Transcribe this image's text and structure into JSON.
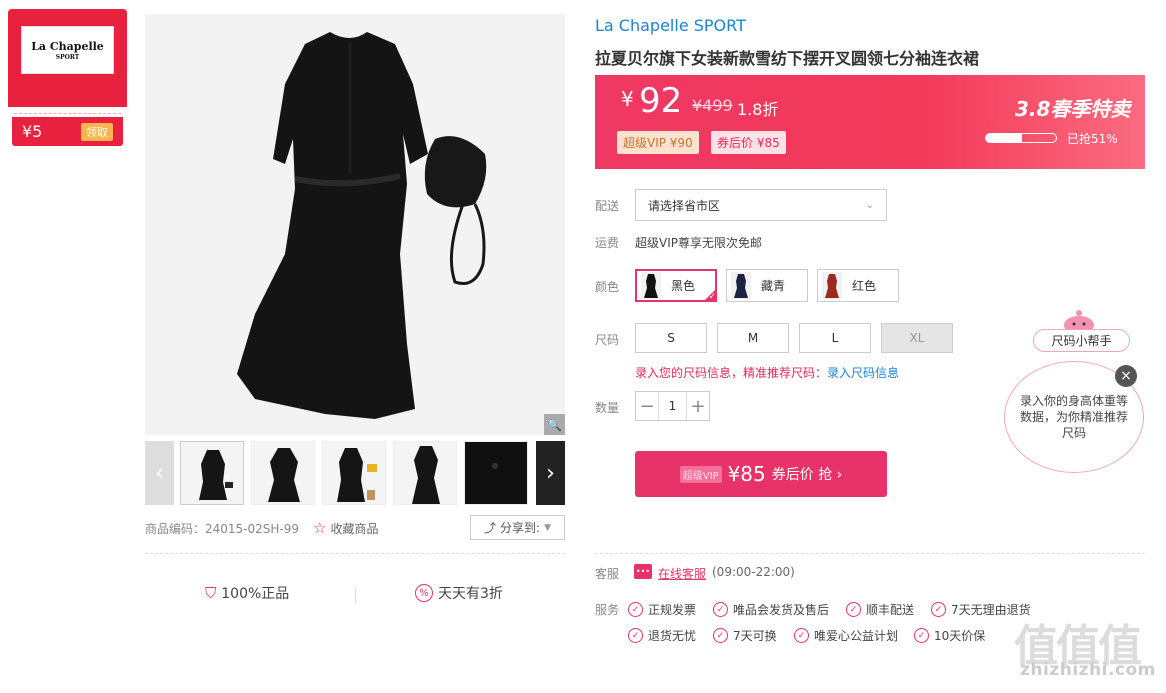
{
  "coupon": {
    "brand_line1": "La Chapelle",
    "brand_line2": "SPORT",
    "amount": "¥5",
    "claim_label": "领取"
  },
  "gallery": {
    "product_code_label": "商品编码：24015-02SH-99",
    "favorite_label": "收藏商品",
    "share_label": "分享到: ",
    "prev_arrow": "‹",
    "next_arrow": "›",
    "zoom_icon": "🔍"
  },
  "guarantees": [
    {
      "label": "100%正品"
    },
    {
      "label": "天天有3折"
    }
  ],
  "product": {
    "brand": "La Chapelle SPORT",
    "title": "拉夏贝尔旗下女装新款雪纺下摆开叉圆领七分袖连衣裙"
  },
  "price": {
    "yen": "¥",
    "current": "92",
    "original": "¥499",
    "discount": "1.8折",
    "vip_tag": "超级VIP ¥90",
    "coupon_tag": "券后价 ¥85",
    "promo_title": "3.8春季特卖",
    "sold_label": "已抢51%",
    "sold_fraction": 0.51
  },
  "delivery": {
    "label": "配送",
    "select_value": "请选择省市区",
    "freight_label": "运费",
    "freight_value": "超级VIP尊享无限次免邮"
  },
  "colors": {
    "label": "颜色",
    "options": [
      {
        "name": "黑色",
        "swatch": "#111111"
      },
      {
        "name": "藏青",
        "swatch": "#1b2340"
      },
      {
        "name": "红色",
        "swatch": "#9c2a1e"
      }
    ]
  },
  "sizes": {
    "label": "尺码",
    "options": [
      "S",
      "M",
      "L",
      "XL"
    ],
    "info_text": "录入您的尺码信息，精准推荐尺码：",
    "info_link": "录入尺码信息"
  },
  "quantity": {
    "label": "数量",
    "value": "1",
    "minus": "−",
    "plus": "+"
  },
  "buy_button": {
    "vip": "超级VIP",
    "price": "¥85",
    "action": "券后价 抢 ›"
  },
  "customer_service": {
    "label": "客服",
    "link": "在线客服",
    "hours": "(09:00-22:00)"
  },
  "services": {
    "label": "服务",
    "items": [
      "正规发票",
      "唯品会发货及售后",
      "顺丰配送",
      "7天无理由退货",
      "退货无忧",
      "7天可换",
      "唯爱心公益计划",
      "10天价保"
    ]
  },
  "size_helper": {
    "tag": "尺码小帮手",
    "bubble": "录入你的身高体重等数据，为你精准推荐尺码",
    "close": "×"
  },
  "watermark": {
    "text": "zhizhizhi.com",
    "logo": "值值值"
  },
  "colors_theme": {
    "accent": "#e8326a",
    "brand_blue": "#1a83d6",
    "coupon_red": "#e8213f"
  }
}
